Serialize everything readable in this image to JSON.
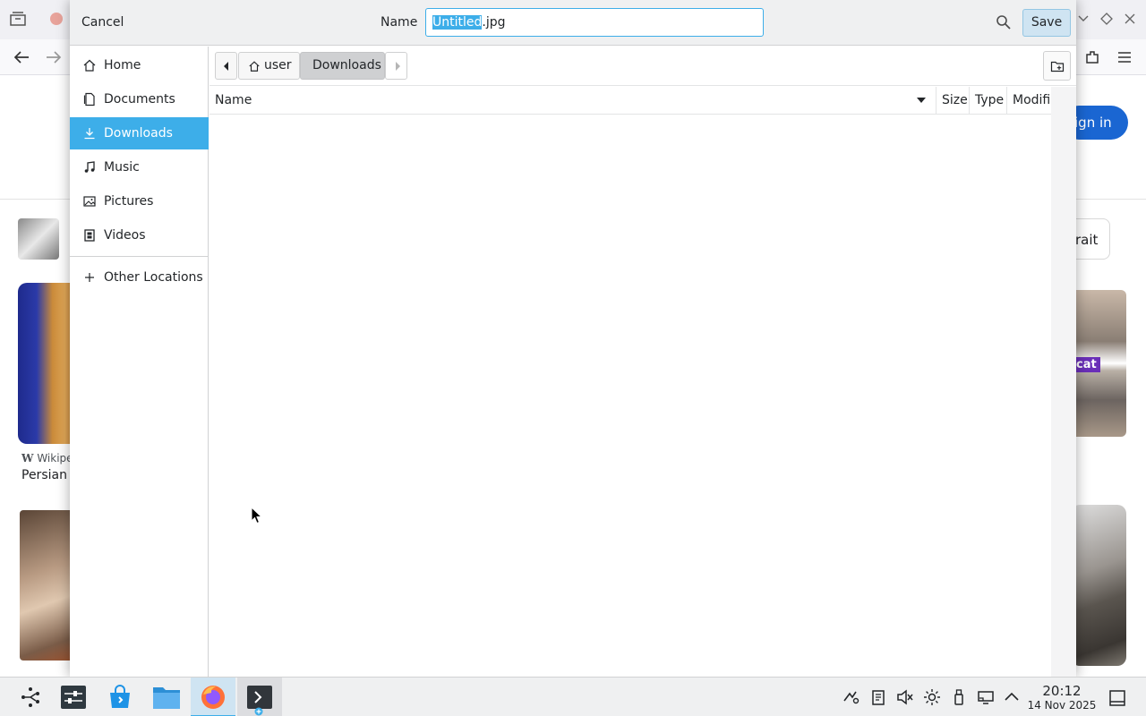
{
  "browser": {
    "sign_in_label": "ign in",
    "chip_label": "rait",
    "result_source": "Wikipe",
    "result_title": "Persian",
    "image_label": "cat"
  },
  "dialog": {
    "cancel_label": "Cancel",
    "name_label": "Name",
    "filename_selected": "Untitled",
    "filename_rest": ".jpg",
    "save_label": "Save",
    "places": [
      {
        "label": "Home",
        "icon": "home-icon"
      },
      {
        "label": "Documents",
        "icon": "document-icon"
      },
      {
        "label": "Downloads",
        "icon": "download-icon",
        "active": true
      },
      {
        "label": "Music",
        "icon": "music-icon"
      },
      {
        "label": "Pictures",
        "icon": "picture-icon"
      },
      {
        "label": "Videos",
        "icon": "video-icon"
      }
    ],
    "other_locations": "Other Locations",
    "path": [
      "user",
      "Downloads"
    ],
    "columns": [
      "Name",
      "Size",
      "Type",
      "Modifie"
    ]
  },
  "taskbar": {
    "time": "20:12",
    "date": "14 Nov 2025"
  },
  "colors": {
    "accent": "#3daee9",
    "browser_button": "#1a66d2"
  }
}
